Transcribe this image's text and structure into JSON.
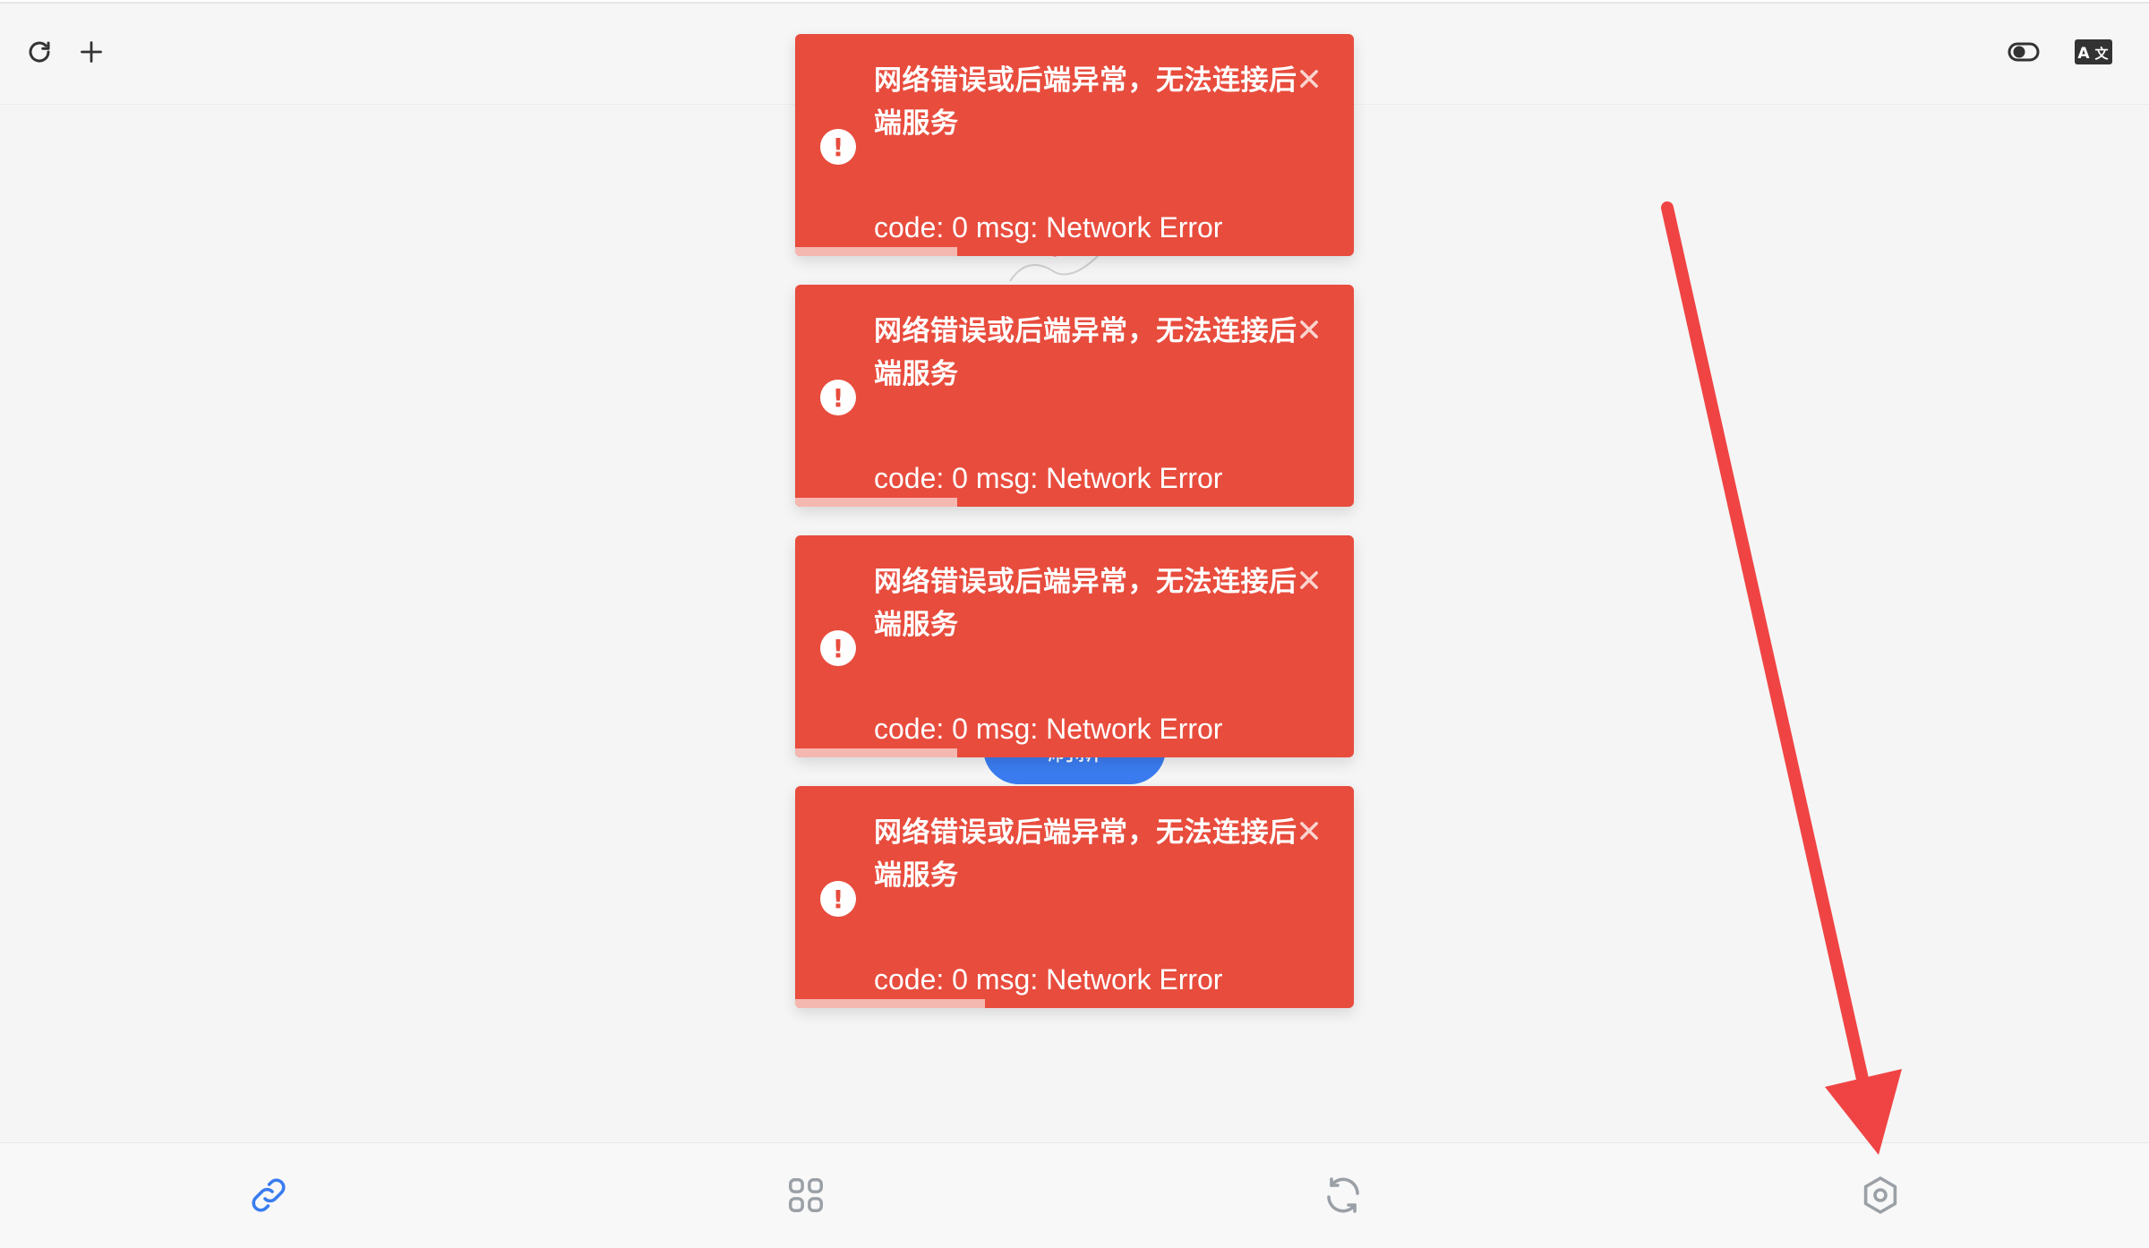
{
  "topbar": {
    "left_icons": [
      "refresh-icon",
      "plus-icon"
    ],
    "right_icons": [
      "toggle-icon",
      "translate-icon"
    ]
  },
  "background": {
    "button_label": "刷新"
  },
  "toasts": [
    {
      "title": "网络错误或后端异常，无法连接后端服务",
      "message": "code: 0 msg: Network Error",
      "icon": "error-icon",
      "progress": 0.29
    },
    {
      "title": "网络错误或后端异常，无法连接后端服务",
      "message": "code: 0 msg: Network Error",
      "icon": "error-icon",
      "progress": 0.29
    },
    {
      "title": "网络错误或后端异常，无法连接后端服务",
      "message": "code: 0 msg: Network Error",
      "icon": "error-icon",
      "progress": 0.29
    },
    {
      "title": "网络错误或后端异常，无法连接后端服务",
      "message": "code: 0 msg: Network Error",
      "icon": "error-icon",
      "progress": 0.34
    }
  ],
  "bottom_nav": [
    {
      "icon": "link-icon",
      "active": true
    },
    {
      "icon": "grid-icon",
      "active": false
    },
    {
      "icon": "sync-icon",
      "active": false
    },
    {
      "icon": "settings-hexagon-icon",
      "active": false
    }
  ],
  "colors": {
    "toast_bg": "#e84c3d",
    "active_nav": "#3a7cf0",
    "inactive_nav": "#9aa0a6",
    "annotation_arrow": "#f04444"
  }
}
